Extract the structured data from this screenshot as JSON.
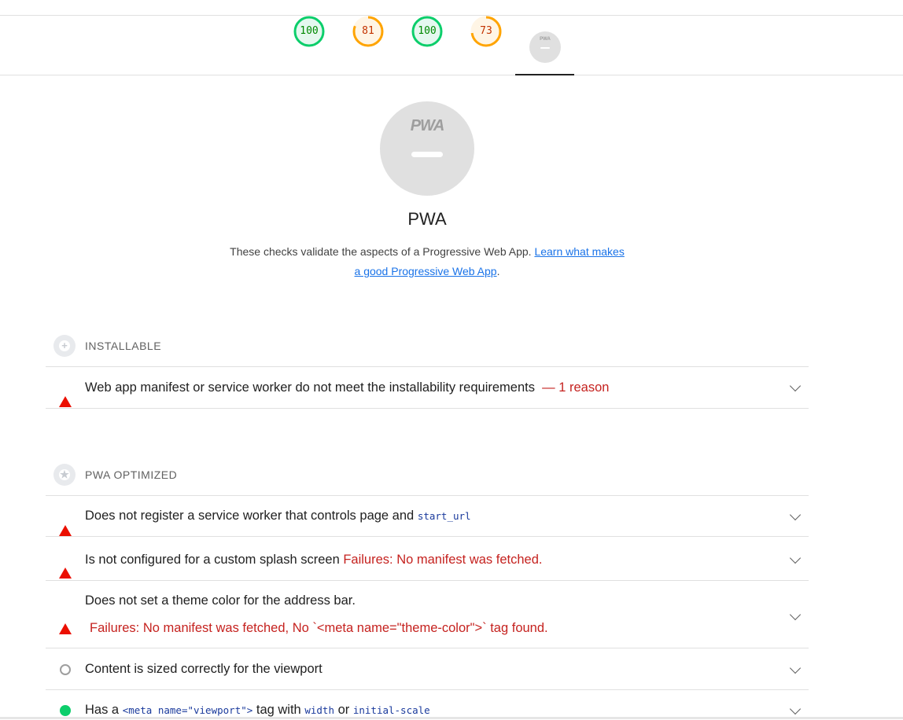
{
  "gauges": [
    {
      "value": "100",
      "score": 1.0,
      "color": "#0cce6b"
    },
    {
      "value": "81",
      "score": 0.81,
      "color": "#ffa400"
    },
    {
      "value": "100",
      "score": 1.0,
      "color": "#0cce6b"
    },
    {
      "value": "73",
      "score": 0.73,
      "color": "#ffa400"
    }
  ],
  "pwa_tab": {
    "logo": "PWA",
    "icon": "pwa-badge-icon"
  },
  "category": {
    "badge_logo": "PWA",
    "title": "PWA",
    "description": "These checks validate the aspects of a Progressive Web App.",
    "link_text": "Learn what makes a good Progressive Web App",
    "link_suffix": "."
  },
  "groups": {
    "installable": {
      "label": "INSTALLABLE",
      "icon": "plus-icon"
    },
    "pwa_optimized": {
      "label": "PWA OPTIMIZED",
      "icon": "star-icon"
    }
  },
  "audits": {
    "installable_manifest": {
      "title": "Web app manifest or service worker do not meet the installability requirements",
      "extra": "— 1 reason",
      "status": "fail"
    },
    "service_worker": {
      "title": "Does not register a service worker that controls page and",
      "code": "start_url",
      "status": "fail"
    },
    "splash_screen": {
      "title": "Is not configured for a custom splash screen",
      "failure": "Failures: No manifest was fetched.",
      "status": "fail"
    },
    "theme_color": {
      "title": "Does not set a theme color for the address bar.",
      "failure": "Failures: No manifest was fetched, No `<meta name=\"theme-color\">` tag found.",
      "status": "fail"
    },
    "content_width": {
      "title": "Content is sized correctly for the viewport",
      "status": "manual"
    },
    "viewport": {
      "prefix": "Has a",
      "code1": "<meta name=\"viewport\">",
      "mid": "tag with",
      "code2": "width",
      "mid2": "or",
      "code3": "initial-scale",
      "status": "pass"
    }
  },
  "colors": {
    "fail": "#eb0f00",
    "pass": "#0cce6b",
    "average": "#ffa400",
    "link": "#1a73e8"
  }
}
